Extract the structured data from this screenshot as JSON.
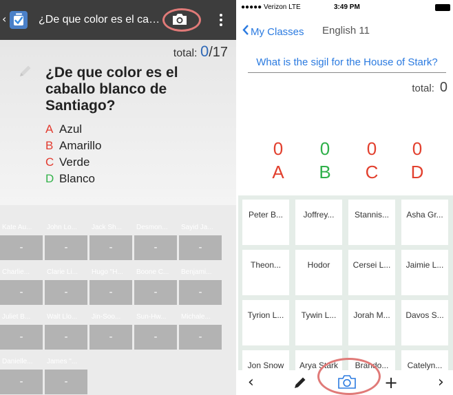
{
  "android": {
    "back_glyph": "‹",
    "app_icon": "app-checkmark-icon",
    "title": "¿De que color es el caballo blanco de Santiago?",
    "camera_icon": "camera-icon",
    "menu_icon": "overflow-menu-icon",
    "total_label": "total:",
    "total_count": "0",
    "total_sep": "/",
    "total_max": "17",
    "question": "¿De que color es el caballo blanco de Santiago?",
    "choices": [
      {
        "key": "A",
        "text": "Azul",
        "color": "#e23a2e"
      },
      {
        "key": "B",
        "text": "Amarillo",
        "color": "#e23a2e"
      },
      {
        "key": "C",
        "text": "Verde",
        "color": "#e23a2e"
      },
      {
        "key": "D",
        "text": "Blanco",
        "color": "#33b24a"
      }
    ],
    "students": [
      {
        "name": "Kate Au...",
        "value": "-"
      },
      {
        "name": "John Lo...",
        "value": "-"
      },
      {
        "name": "Jack Sh...",
        "value": "-"
      },
      {
        "name": "Desmon...",
        "value": "-"
      },
      {
        "name": "Sayid Ja...",
        "value": "-"
      },
      {
        "name": "Charlie...",
        "value": "-"
      },
      {
        "name": "Clarie Li...",
        "value": "-"
      },
      {
        "name": "Hugo \"H...",
        "value": "-"
      },
      {
        "name": "Boone C...",
        "value": "-"
      },
      {
        "name": "Benjami...",
        "value": "-"
      },
      {
        "name": "Juliet B...",
        "value": "-"
      },
      {
        "name": "Walt Llo...",
        "value": "-"
      },
      {
        "name": "Jin-Soo...",
        "value": "-"
      },
      {
        "name": "Sun-Hw...",
        "value": "-"
      },
      {
        "name": "Michale...",
        "value": "-"
      },
      {
        "name": "Danielle...",
        "value": "-"
      },
      {
        "name": "James \"...",
        "value": "-"
      }
    ]
  },
  "ios": {
    "carrier": "●●●●● Verizon  LTE",
    "time": "3:49 PM",
    "back_label": "My Classes",
    "nav_title": "English 11",
    "question": "What is the sigil for the House of Stark?",
    "total_label": "total:",
    "total_count": "0",
    "answers": [
      {
        "letter": "A",
        "count": "0",
        "color": "#e2402e"
      },
      {
        "letter": "B",
        "count": "0",
        "color": "#2fb04a"
      },
      {
        "letter": "C",
        "count": "0",
        "color": "#e2402e"
      },
      {
        "letter": "D",
        "count": "0",
        "color": "#e2402e"
      }
    ],
    "students": [
      "Peter B...",
      "Joffrey...",
      "Stannis...",
      "Asha Gr...",
      "Theon...",
      "Hodor",
      "Cersei L...",
      "Jaimie L...",
      "Tyrion L...",
      "Tywin L...",
      "Jorah M...",
      "Davos S...",
      "Jon Snow",
      "Arya Stark",
      "Brando...",
      "Catelyn..."
    ],
    "toolbar": {
      "back_glyph": "‹",
      "pencil_icon": "pencil-icon",
      "camera_icon": "camera-icon",
      "plus_glyph": "+",
      "forward_glyph": "›"
    }
  },
  "colors": {
    "android_bar": "#3d3d3d",
    "android_accent": "#2f69b7",
    "ios_blue": "#2a7ae0",
    "highlight_ring": "#e07a78",
    "tile_grey": "#b3b3b3"
  }
}
